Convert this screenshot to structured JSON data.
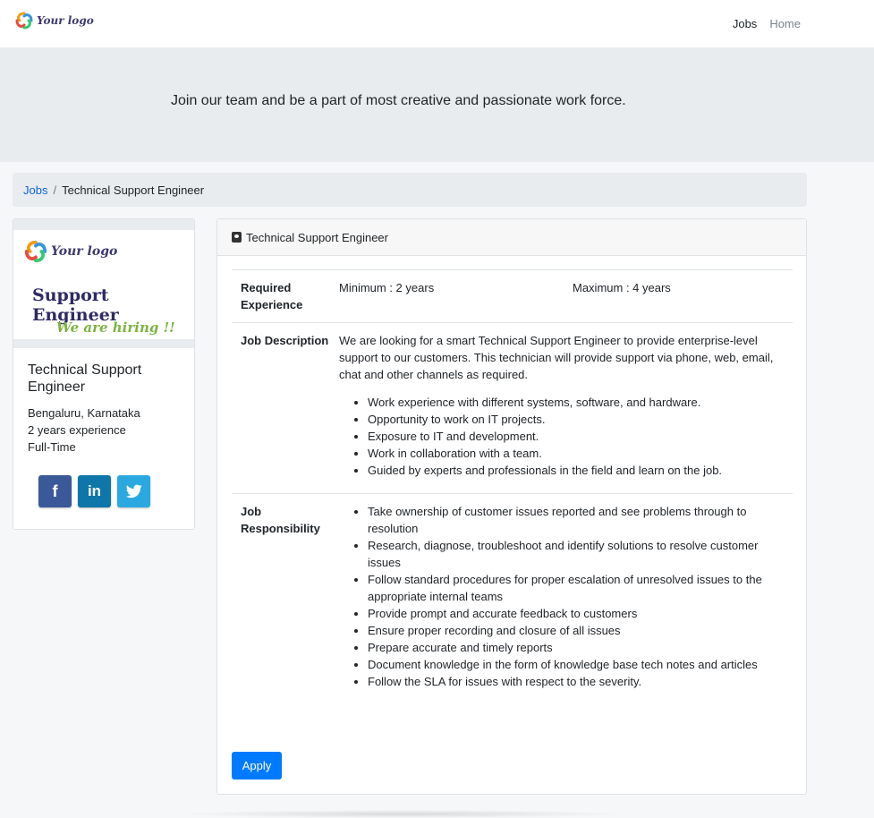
{
  "nav": {
    "logo_text": "Your logo",
    "links": [
      "Jobs",
      "Home"
    ]
  },
  "hero": {
    "tagline": "Join our team and be a part of most creative and passionate work force."
  },
  "breadcrumb": {
    "root": "Jobs",
    "separator": "/",
    "current": "Technical Support Engineer"
  },
  "side": {
    "banner": {
      "logo_text": "Your logo",
      "headline": "Support Engineer",
      "hiring": "We are hiring !!"
    },
    "title": "Technical Support Engineer",
    "location": "Bengaluru, Karnataka",
    "experience": "2 years experience",
    "type": "Full-Time",
    "social": {
      "facebook": "f",
      "linkedin": "in",
      "twitter": "twitter-bird-icon"
    }
  },
  "job": {
    "header_title": "Technical Support Engineer",
    "experience_label": "Required Experience",
    "min": "Minimum : 2 years",
    "max": "Maximum : 4 years",
    "description_label": "Job Description",
    "description_text": "We are looking for a smart Technical Support Engineer to provide enterprise-level support to our customers. This technician will provide support via phone, web, email, chat and other channels as required.",
    "description_points": [
      "Work experience with different systems, software, and hardware.",
      "Opportunity to work on IT projects.",
      "Exposure to IT and development.",
      "Work in collaboration with a team.",
      "Guided by experts and professionals in the field and learn on the job."
    ],
    "responsibility_label": "Job Responsibility",
    "responsibilities": [
      "Take ownership of customer issues reported and see problems through to resolution",
      "Research, diagnose, troubleshoot and identify solutions to resolve customer issues",
      "Follow standard procedures for proper escalation of unresolved issues to the appropriate internal teams",
      "Provide prompt and accurate feedback to customers",
      "Ensure proper recording and closure of all issues",
      "Prepare accurate and timely reports",
      "Document knowledge in the form of knowledge base tech notes and articles",
      "Follow the SLA for issues with respect to the severity."
    ],
    "apply_label": "Apply"
  },
  "colors": {
    "accent": "#007bff",
    "link": "#0a66d6",
    "facebook": "#3b5998",
    "linkedin": "#0e76a8",
    "twitter": "#2aa9e0"
  }
}
